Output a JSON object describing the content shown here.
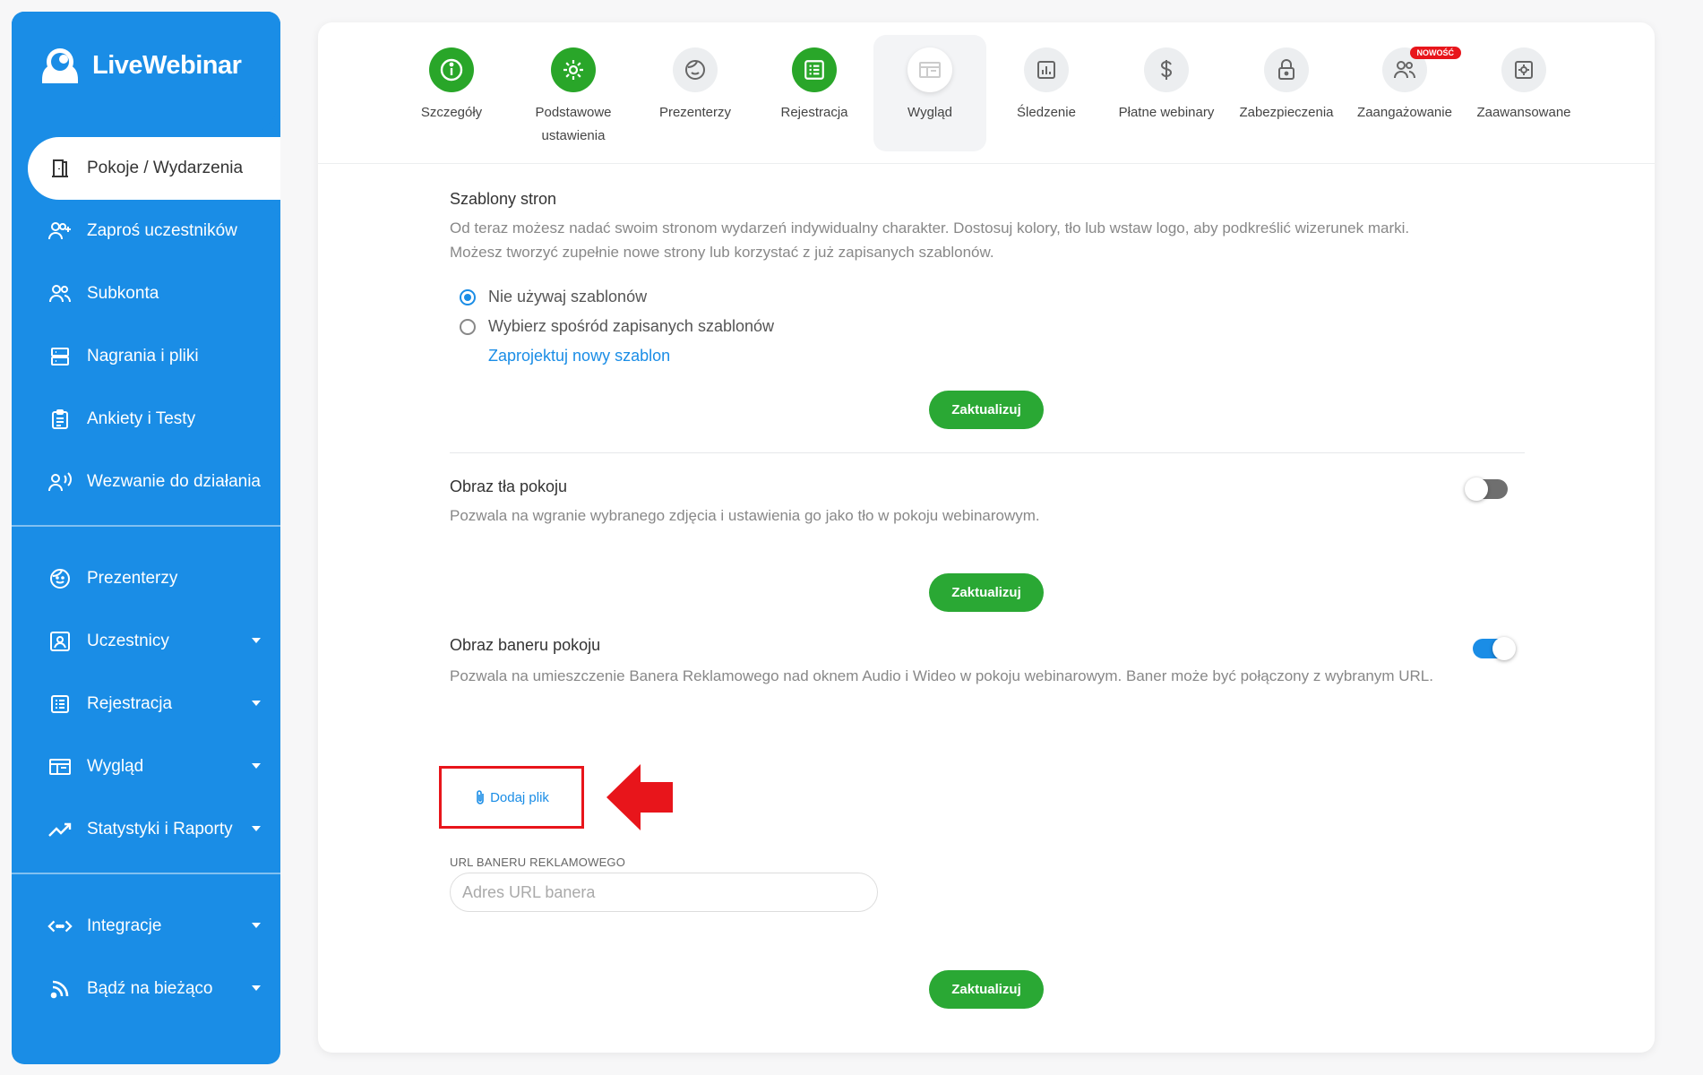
{
  "brand": {
    "name": "LiveWebinar"
  },
  "sidebar": {
    "items": [
      {
        "label": "Pokoje / Wydarzenia",
        "icon": "door-icon",
        "active": true
      },
      {
        "label": "Zaproś uczestników",
        "icon": "add-user-icon"
      },
      {
        "label": "Subkonta",
        "icon": "users-icon"
      },
      {
        "label": "Nagrania i pliki",
        "icon": "server-icon"
      },
      {
        "label": "Ankiety i Testy",
        "icon": "clipboard-icon"
      },
      {
        "label": "Wezwanie do działania",
        "icon": "megaphone-user-icon"
      },
      {
        "label": "Prezenterzy",
        "icon": "presenter-face-icon"
      },
      {
        "label": "Uczestnicy",
        "icon": "attendee-icon",
        "dropdown": true
      },
      {
        "label": "Rejestracja",
        "icon": "form-icon",
        "dropdown": true
      },
      {
        "label": "Wygląd",
        "icon": "layout-icon",
        "dropdown": true
      },
      {
        "label": "Statystyki i Raporty",
        "icon": "trend-icon",
        "dropdown": true
      },
      {
        "label": "Integracje",
        "icon": "code-arrows-icon",
        "dropdown": true
      },
      {
        "label": "Bądź na bieżąco",
        "icon": "rss-icon",
        "dropdown": true
      }
    ]
  },
  "tabs": [
    {
      "label": "Szczegóły",
      "icon": "info-icon",
      "state": "done"
    },
    {
      "label": "Podstawowe ustawienia",
      "icon": "gear-icon",
      "state": "done"
    },
    {
      "label": "Prezenterzy",
      "icon": "presenter-face-icon",
      "state": "todo"
    },
    {
      "label": "Rejestracja",
      "icon": "form-icon",
      "state": "done"
    },
    {
      "label": "Wygląd",
      "icon": "layout-icon",
      "state": "active"
    },
    {
      "label": "Śledzenie",
      "icon": "bar-chart-icon",
      "state": "todo"
    },
    {
      "label": "Płatne webinary",
      "icon": "dollar-icon",
      "state": "todo"
    },
    {
      "label": "Zabezpieczenia",
      "icon": "lock-icon",
      "state": "todo"
    },
    {
      "label": "Zaangażowanie",
      "icon": "users-icon",
      "state": "todo",
      "badge": "NOWOŚĆ"
    },
    {
      "label": "Zaawansowane",
      "icon": "settings-box-icon",
      "state": "todo"
    }
  ],
  "templates": {
    "title": "Szablony stron",
    "description": "Od teraz możesz nadać swoim stronom wydarzeń indywidualny charakter. Dostosuj kolory, tło lub wstaw logo, aby podkreślić wizerunek marki. Możesz tworzyć zupełnie nowe strony lub korzystać z już zapisanych szablonów.",
    "option_none": "Nie używaj szablonów",
    "option_saved": "Wybierz spośród zapisanych szablonów",
    "design_link": "Zaprojektuj nowy szablon",
    "selected": "none",
    "update_label": "Zaktualizuj"
  },
  "background": {
    "title": "Obraz tła pokoju",
    "description": "Pozwala na wgranie wybranego zdjęcia i ustawienia go jako tło w pokoju webinarowym.",
    "enabled": false,
    "update_label": "Zaktualizuj"
  },
  "banner": {
    "title": "Obraz baneru pokoju",
    "description": "Pozwala na umieszczenie Banera Reklamowego nad oknem Audio i Wideo w pokoju webinarowym. Baner może być połączony z wybranym URL.",
    "enabled": true,
    "add_file_label": "Dodaj plik",
    "url_label": "URL BANERU REKLAMOWEGO",
    "url_placeholder": "Adres URL banera",
    "url_value": "",
    "update_label": "Zaktualizuj"
  },
  "colors": {
    "brand_blue": "#1a8de6",
    "green": "#2aa834",
    "highlight_red": "#e8151b"
  }
}
